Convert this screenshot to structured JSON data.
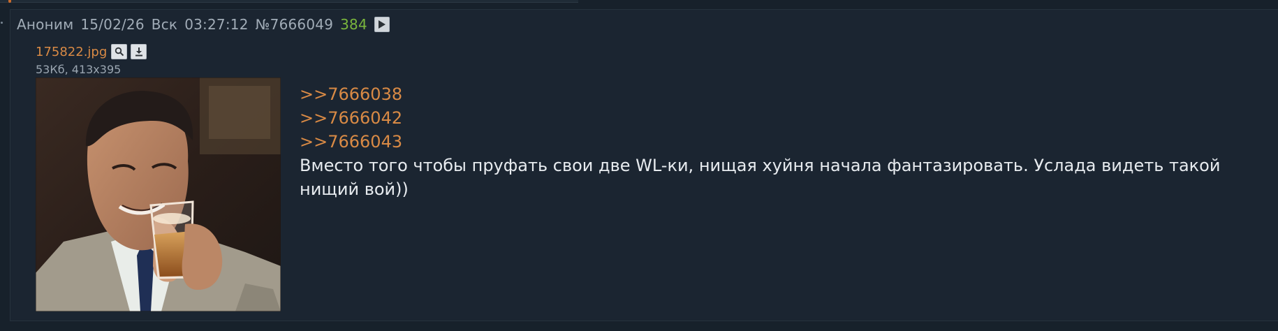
{
  "post": {
    "author": "Аноним",
    "date": "15/02/26",
    "day": "Вск",
    "time": "03:27:12",
    "number": "№7666049",
    "reply_count": "384",
    "play_icon": "play-icon",
    "file": {
      "name": "175822.jpg",
      "search_icon": "search-icon",
      "download_icon": "download-icon",
      "meta": "53Кб, 413x395"
    },
    "links": [
      ">>7666038",
      ">>7666042",
      ">>7666043"
    ],
    "text": "Вместо того чтобы пруфать свои две WL-ки, нищая хуйня начала фантазировать. Услада видеть такой нищий вой))"
  },
  "colors": {
    "background": "#17212b",
    "post_background": "#1b2531",
    "accent": "#d98a45",
    "reply_count": "#7ab63d",
    "meta_text": "#a1acb7",
    "body_text": "#e7ebef"
  }
}
